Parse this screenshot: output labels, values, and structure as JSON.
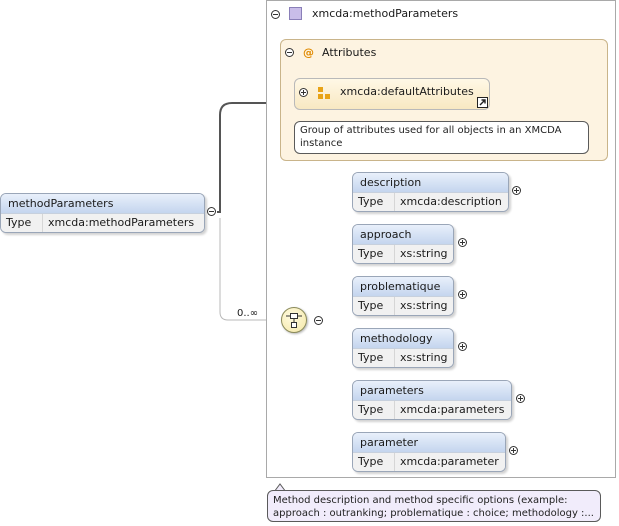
{
  "root": {
    "name": "methodParameters",
    "type_key": "Type",
    "type_value": "xmcda:methodParameters"
  },
  "complex_type": {
    "name": "xmcda:methodParameters"
  },
  "attributes": {
    "symbol": "@",
    "label": "Attributes",
    "group": {
      "name": "xmcda:defaultAttributes",
      "doc": "Group of attributes used for all objects in an XMCDA instance"
    }
  },
  "sequence": {
    "cardinality": "0..∞"
  },
  "children": [
    {
      "name": "description",
      "type_key": "Type",
      "type_value": "xmcda:description"
    },
    {
      "name": "approach",
      "type_key": "Type",
      "type_value": "xs:string"
    },
    {
      "name": "problematique",
      "type_key": "Type",
      "type_value": "xs:string"
    },
    {
      "name": "methodology",
      "type_key": "Type",
      "type_value": "xs:string"
    },
    {
      "name": "parameters",
      "type_key": "Type",
      "type_value": "xmcda:parameters"
    },
    {
      "name": "parameter",
      "type_key": "Type",
      "type_value": "xmcda:parameter"
    }
  ],
  "documentation": "Method description and method specific options (example: approach : outranking; problematique : choice; methodology :..."
}
